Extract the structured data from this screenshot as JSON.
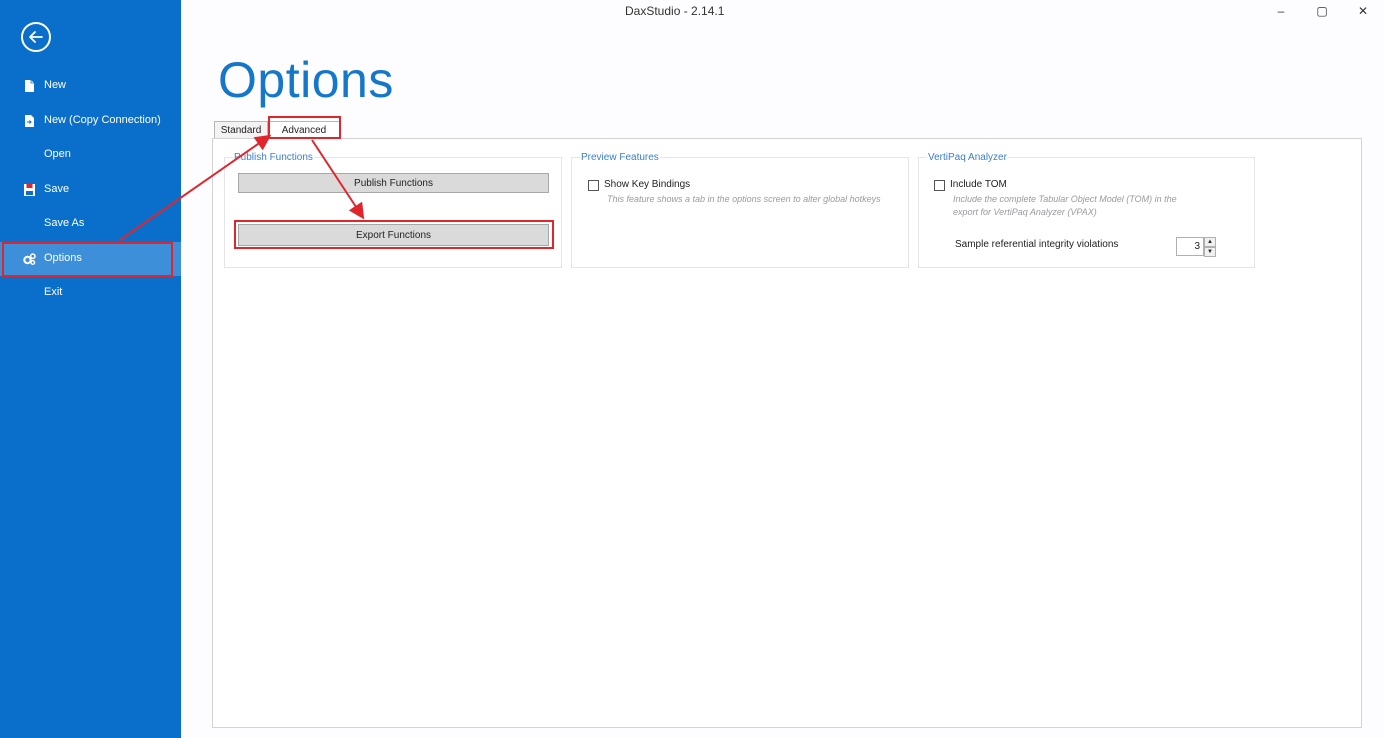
{
  "window": {
    "title": "DaxStudio - 2.14.1",
    "controls": {
      "minimize": "–",
      "maximize": "▢",
      "close": "✕"
    }
  },
  "sidebar": {
    "back_icon": "arrow-left-icon",
    "items": [
      {
        "label": "New",
        "icon": "document-icon"
      },
      {
        "label": "New (Copy Connection)",
        "icon": "document-arrow-icon"
      },
      {
        "label": "Open",
        "icon": ""
      },
      {
        "label": "Save",
        "icon": "floppy-disk-icon"
      },
      {
        "label": "Save As",
        "icon": ""
      },
      {
        "label": "Options",
        "icon": "gears-icon",
        "active": true
      },
      {
        "label": "Exit",
        "icon": ""
      }
    ]
  },
  "page": {
    "title": "Options",
    "tabs": [
      {
        "label": "Standard",
        "active": false
      },
      {
        "label": "Advanced",
        "active": true
      }
    ]
  },
  "groups": {
    "publish": {
      "title": "Publish Functions",
      "publish_button": "Publish Functions",
      "export_button": "Export Functions"
    },
    "preview": {
      "title": "Preview Features",
      "checkbox_label": "Show Key Bindings",
      "checked": false,
      "description": "This feature shows a tab in the options screen to alter global hotkeys"
    },
    "vertipaq": {
      "title": "VertiPaq Analyzer",
      "checkbox_label": "Include TOM",
      "checked": false,
      "description": "Include the complete Tabular Object Model (TOM) in the export for VertiPaq Analyzer (VPAX)",
      "sample_label": "Sample referential integrity violations",
      "sample_value": "3"
    }
  },
  "colors": {
    "sidebar": "#0a6fcb",
    "accent": "#1577c9",
    "highlight": "#e0262c"
  }
}
